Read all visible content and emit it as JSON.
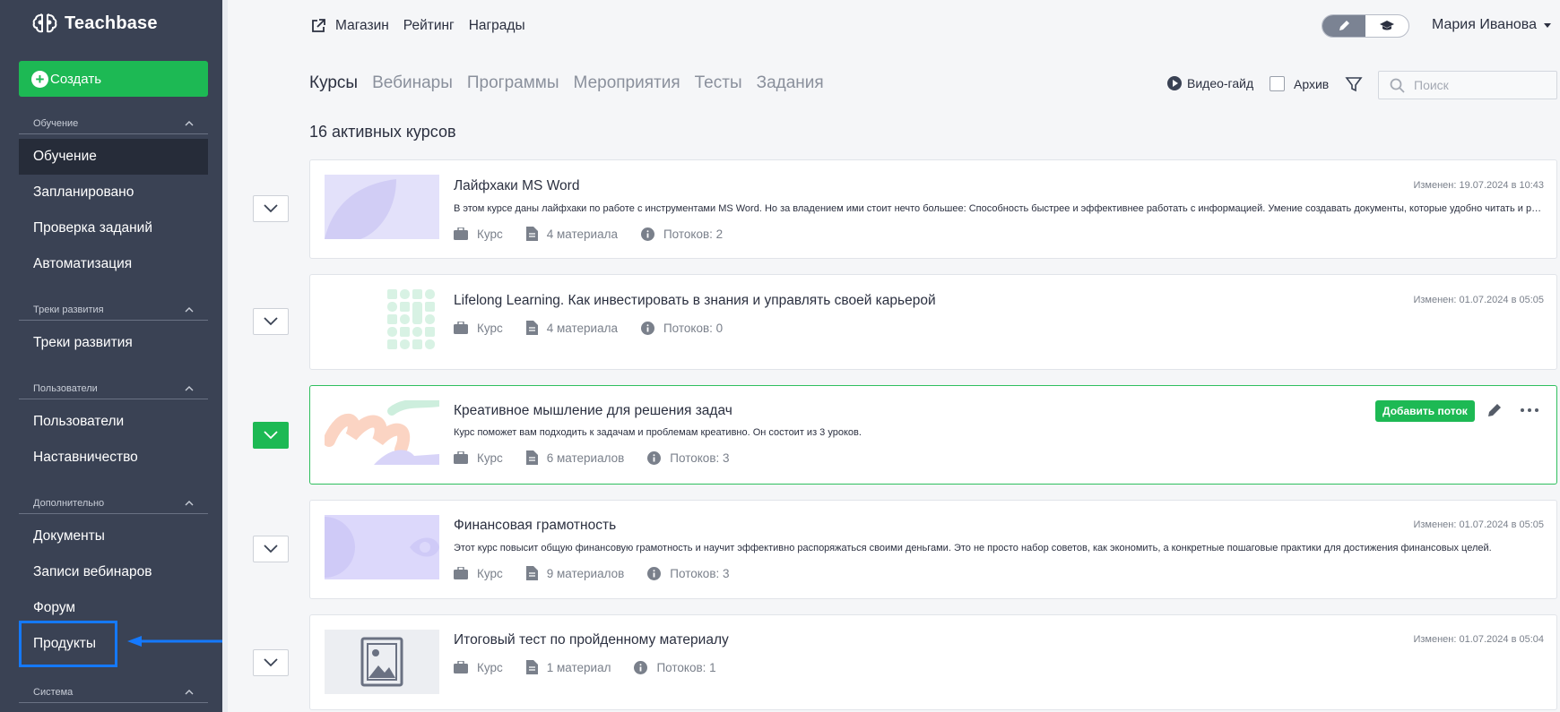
{
  "brand": {
    "name": "Teachbase"
  },
  "sidebar": {
    "create_label": "Создать",
    "sections": [
      {
        "title": "Обучение",
        "items": [
          {
            "label": "Обучение",
            "active": true
          },
          {
            "label": "Запланировано"
          },
          {
            "label": "Проверка заданий"
          },
          {
            "label": "Автоматизация"
          }
        ]
      },
      {
        "title": "Треки развития",
        "items": [
          {
            "label": "Треки развития"
          }
        ]
      },
      {
        "title": "Пользователи",
        "items": [
          {
            "label": "Пользователи"
          },
          {
            "label": "Наставничество"
          }
        ]
      },
      {
        "title": "Дополнительно",
        "items": [
          {
            "label": "Документы"
          },
          {
            "label": "Записи вебинаров"
          },
          {
            "label": "Форум"
          },
          {
            "label": "Продукты",
            "highlighted": true
          }
        ]
      },
      {
        "title": "Система",
        "items": []
      }
    ]
  },
  "topnav": {
    "links": [
      "Магазин",
      "Рейтинг",
      "Награды"
    ]
  },
  "user": {
    "name": "Мария Иванова"
  },
  "tabs": [
    "Курсы",
    "Вебинары",
    "Программы",
    "Мероприятия",
    "Тесты",
    "Задания"
  ],
  "toolbar": {
    "video_guide": "Видео-гайд",
    "archive": "Архив",
    "search_placeholder": "Поиск"
  },
  "count_label": "16 активных курсов",
  "courses": [
    {
      "title": "Лайфхаки MS Word",
      "description": "В этом курсе даны лайфхаки по работе с инструментами MS Word. Но за владением ими стоит нечто большее: Способность быстрее и эффективнее работать с информацией. Умение создавать документы, которые удобно читать и редактировать.",
      "type": "Курс",
      "materials": "4 материала",
      "streams": "Потоков: 2",
      "modified": "Изменен: 19.07.2024 в 10:43"
    },
    {
      "title": "Lifelong Learning. Как инвестировать в знания и управлять своей карьерой",
      "description": "",
      "type": "Курс",
      "materials": "4 материала",
      "streams": "Потоков: 0",
      "modified": "Изменен: 01.07.2024 в 05:05"
    },
    {
      "title": "Креативное мышление для решения задач",
      "description": "Курс поможет вам подходить к задачам и проблемам креативно. Он состоит из 3 уроков.",
      "type": "Курс",
      "materials": "6 материалов",
      "streams": "Потоков: 3",
      "add_stream": "Добавить поток"
    },
    {
      "title": "Финансовая грамотность",
      "description": "Этот курс повысит общую финансовую грамотность и научит эффективно распоряжаться своими деньгами. Это не просто набор советов, как экономить, а конкретные пошаговые практики для достижения финансовых целей.",
      "type": "Курс",
      "materials": "9 материалов",
      "streams": "Потоков: 3",
      "modified": "Изменен: 01.07.2024 в 05:05"
    },
    {
      "title": "Итоговый тест по пройденному материалу",
      "description": "",
      "type": "Курс",
      "materials": "1 материал",
      "streams": "Потоков: 1",
      "modified": "Изменен: 01.07.2024 в 05:04"
    }
  ],
  "colors": {
    "sidebar": "#3a4254",
    "accent": "#1db954",
    "highlight": "#1479ff"
  }
}
